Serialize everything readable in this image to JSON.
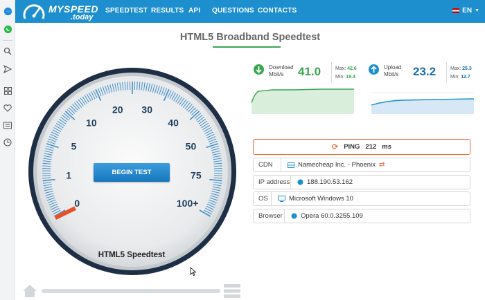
{
  "nav": {
    "logo_main": "MYSPEED",
    "logo_sub": ".today",
    "items": [
      "SPEEDTEST",
      "RESULTS",
      "API",
      "QUESTIONS",
      "CONTACTS"
    ],
    "language": "EN"
  },
  "sidebar": {
    "icons": [
      "messenger-icon",
      "whatsapp-icon",
      "search-icon",
      "send-icon",
      "grid-icon",
      "heart-icon",
      "news-icon",
      "clock-icon"
    ]
  },
  "page": {
    "title": "HTML5 Broadband Speedtest"
  },
  "gauge": {
    "labels": [
      "0",
      "1",
      "5",
      "10",
      "20",
      "30",
      "40",
      "50",
      "75",
      "100+"
    ],
    "button_label": "BEGIN TEST",
    "footer_label": "HTML5 Speedtest",
    "needle_level": 0
  },
  "download": {
    "label_line1": "Download",
    "label_line2": "Mbit/s",
    "value": "41.0",
    "max_label": "Max:",
    "max": "42.6",
    "min_label": "Min:",
    "min": "19.4",
    "color": "#3aa651"
  },
  "upload": {
    "label_line1": "Upload",
    "label_line2": "Mbit/s",
    "value": "23.2",
    "max_label": "Max:",
    "max": "25.3",
    "min_label": "Min:",
    "min": "12.7",
    "color": "#1d8fce"
  },
  "ping": {
    "label": "PING",
    "value": "212",
    "unit": "ms",
    "color": "#e86a3a"
  },
  "info": {
    "cdn_key": "CDN",
    "cdn_value": "Namecheap Inc. - Phoenix",
    "ip_key": "IP address",
    "ip_value": "188.190.53.162",
    "os_key": "OS",
    "os_value": "Microsoft Windows 10",
    "browser_key": "Browser",
    "browser_value": "Opera 60.0.3255.109"
  }
}
